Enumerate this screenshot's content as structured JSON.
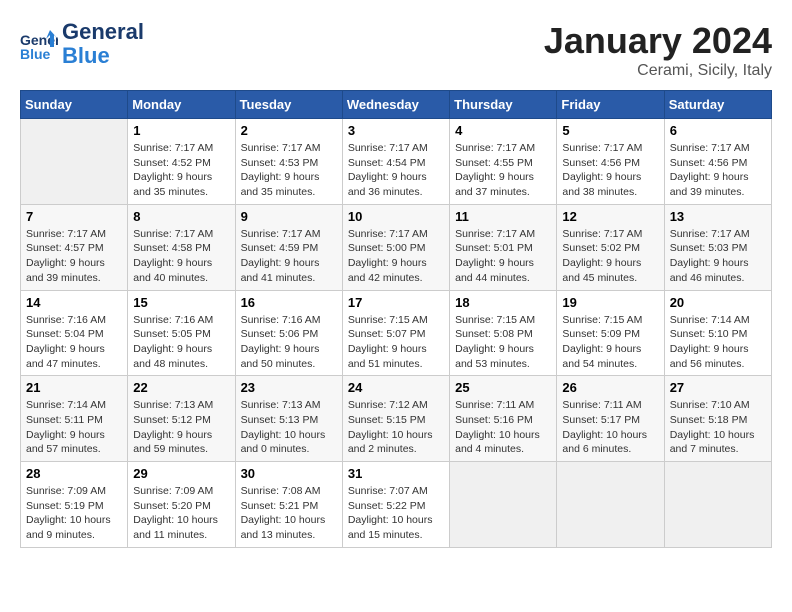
{
  "header": {
    "logo_line1": "General",
    "logo_line2": "Blue",
    "title": "January 2024",
    "subtitle": "Cerami, Sicily, Italy"
  },
  "days_of_week": [
    "Sunday",
    "Monday",
    "Tuesday",
    "Wednesday",
    "Thursday",
    "Friday",
    "Saturday"
  ],
  "weeks": [
    [
      {
        "day": "",
        "sunrise": "",
        "sunset": "",
        "daylight": ""
      },
      {
        "day": "1",
        "sunrise": "Sunrise: 7:17 AM",
        "sunset": "Sunset: 4:52 PM",
        "daylight": "Daylight: 9 hours and 35 minutes."
      },
      {
        "day": "2",
        "sunrise": "Sunrise: 7:17 AM",
        "sunset": "Sunset: 4:53 PM",
        "daylight": "Daylight: 9 hours and 35 minutes."
      },
      {
        "day": "3",
        "sunrise": "Sunrise: 7:17 AM",
        "sunset": "Sunset: 4:54 PM",
        "daylight": "Daylight: 9 hours and 36 minutes."
      },
      {
        "day": "4",
        "sunrise": "Sunrise: 7:17 AM",
        "sunset": "Sunset: 4:55 PM",
        "daylight": "Daylight: 9 hours and 37 minutes."
      },
      {
        "day": "5",
        "sunrise": "Sunrise: 7:17 AM",
        "sunset": "Sunset: 4:56 PM",
        "daylight": "Daylight: 9 hours and 38 minutes."
      },
      {
        "day": "6",
        "sunrise": "Sunrise: 7:17 AM",
        "sunset": "Sunset: 4:56 PM",
        "daylight": "Daylight: 9 hours and 39 minutes."
      }
    ],
    [
      {
        "day": "7",
        "sunrise": "Sunrise: 7:17 AM",
        "sunset": "Sunset: 4:57 PM",
        "daylight": "Daylight: 9 hours and 39 minutes."
      },
      {
        "day": "8",
        "sunrise": "Sunrise: 7:17 AM",
        "sunset": "Sunset: 4:58 PM",
        "daylight": "Daylight: 9 hours and 40 minutes."
      },
      {
        "day": "9",
        "sunrise": "Sunrise: 7:17 AM",
        "sunset": "Sunset: 4:59 PM",
        "daylight": "Daylight: 9 hours and 41 minutes."
      },
      {
        "day": "10",
        "sunrise": "Sunrise: 7:17 AM",
        "sunset": "Sunset: 5:00 PM",
        "daylight": "Daylight: 9 hours and 42 minutes."
      },
      {
        "day": "11",
        "sunrise": "Sunrise: 7:17 AM",
        "sunset": "Sunset: 5:01 PM",
        "daylight": "Daylight: 9 hours and 44 minutes."
      },
      {
        "day": "12",
        "sunrise": "Sunrise: 7:17 AM",
        "sunset": "Sunset: 5:02 PM",
        "daylight": "Daylight: 9 hours and 45 minutes."
      },
      {
        "day": "13",
        "sunrise": "Sunrise: 7:17 AM",
        "sunset": "Sunset: 5:03 PM",
        "daylight": "Daylight: 9 hours and 46 minutes."
      }
    ],
    [
      {
        "day": "14",
        "sunrise": "Sunrise: 7:16 AM",
        "sunset": "Sunset: 5:04 PM",
        "daylight": "Daylight: 9 hours and 47 minutes."
      },
      {
        "day": "15",
        "sunrise": "Sunrise: 7:16 AM",
        "sunset": "Sunset: 5:05 PM",
        "daylight": "Daylight: 9 hours and 48 minutes."
      },
      {
        "day": "16",
        "sunrise": "Sunrise: 7:16 AM",
        "sunset": "Sunset: 5:06 PM",
        "daylight": "Daylight: 9 hours and 50 minutes."
      },
      {
        "day": "17",
        "sunrise": "Sunrise: 7:15 AM",
        "sunset": "Sunset: 5:07 PM",
        "daylight": "Daylight: 9 hours and 51 minutes."
      },
      {
        "day": "18",
        "sunrise": "Sunrise: 7:15 AM",
        "sunset": "Sunset: 5:08 PM",
        "daylight": "Daylight: 9 hours and 53 minutes."
      },
      {
        "day": "19",
        "sunrise": "Sunrise: 7:15 AM",
        "sunset": "Sunset: 5:09 PM",
        "daylight": "Daylight: 9 hours and 54 minutes."
      },
      {
        "day": "20",
        "sunrise": "Sunrise: 7:14 AM",
        "sunset": "Sunset: 5:10 PM",
        "daylight": "Daylight: 9 hours and 56 minutes."
      }
    ],
    [
      {
        "day": "21",
        "sunrise": "Sunrise: 7:14 AM",
        "sunset": "Sunset: 5:11 PM",
        "daylight": "Daylight: 9 hours and 57 minutes."
      },
      {
        "day": "22",
        "sunrise": "Sunrise: 7:13 AM",
        "sunset": "Sunset: 5:12 PM",
        "daylight": "Daylight: 9 hours and 59 minutes."
      },
      {
        "day": "23",
        "sunrise": "Sunrise: 7:13 AM",
        "sunset": "Sunset: 5:13 PM",
        "daylight": "Daylight: 10 hours and 0 minutes."
      },
      {
        "day": "24",
        "sunrise": "Sunrise: 7:12 AM",
        "sunset": "Sunset: 5:15 PM",
        "daylight": "Daylight: 10 hours and 2 minutes."
      },
      {
        "day": "25",
        "sunrise": "Sunrise: 7:11 AM",
        "sunset": "Sunset: 5:16 PM",
        "daylight": "Daylight: 10 hours and 4 minutes."
      },
      {
        "day": "26",
        "sunrise": "Sunrise: 7:11 AM",
        "sunset": "Sunset: 5:17 PM",
        "daylight": "Daylight: 10 hours and 6 minutes."
      },
      {
        "day": "27",
        "sunrise": "Sunrise: 7:10 AM",
        "sunset": "Sunset: 5:18 PM",
        "daylight": "Daylight: 10 hours and 7 minutes."
      }
    ],
    [
      {
        "day": "28",
        "sunrise": "Sunrise: 7:09 AM",
        "sunset": "Sunset: 5:19 PM",
        "daylight": "Daylight: 10 hours and 9 minutes."
      },
      {
        "day": "29",
        "sunrise": "Sunrise: 7:09 AM",
        "sunset": "Sunset: 5:20 PM",
        "daylight": "Daylight: 10 hours and 11 minutes."
      },
      {
        "day": "30",
        "sunrise": "Sunrise: 7:08 AM",
        "sunset": "Sunset: 5:21 PM",
        "daylight": "Daylight: 10 hours and 13 minutes."
      },
      {
        "day": "31",
        "sunrise": "Sunrise: 7:07 AM",
        "sunset": "Sunset: 5:22 PM",
        "daylight": "Daylight: 10 hours and 15 minutes."
      },
      {
        "day": "",
        "sunrise": "",
        "sunset": "",
        "daylight": ""
      },
      {
        "day": "",
        "sunrise": "",
        "sunset": "",
        "daylight": ""
      },
      {
        "day": "",
        "sunrise": "",
        "sunset": "",
        "daylight": ""
      }
    ]
  ]
}
